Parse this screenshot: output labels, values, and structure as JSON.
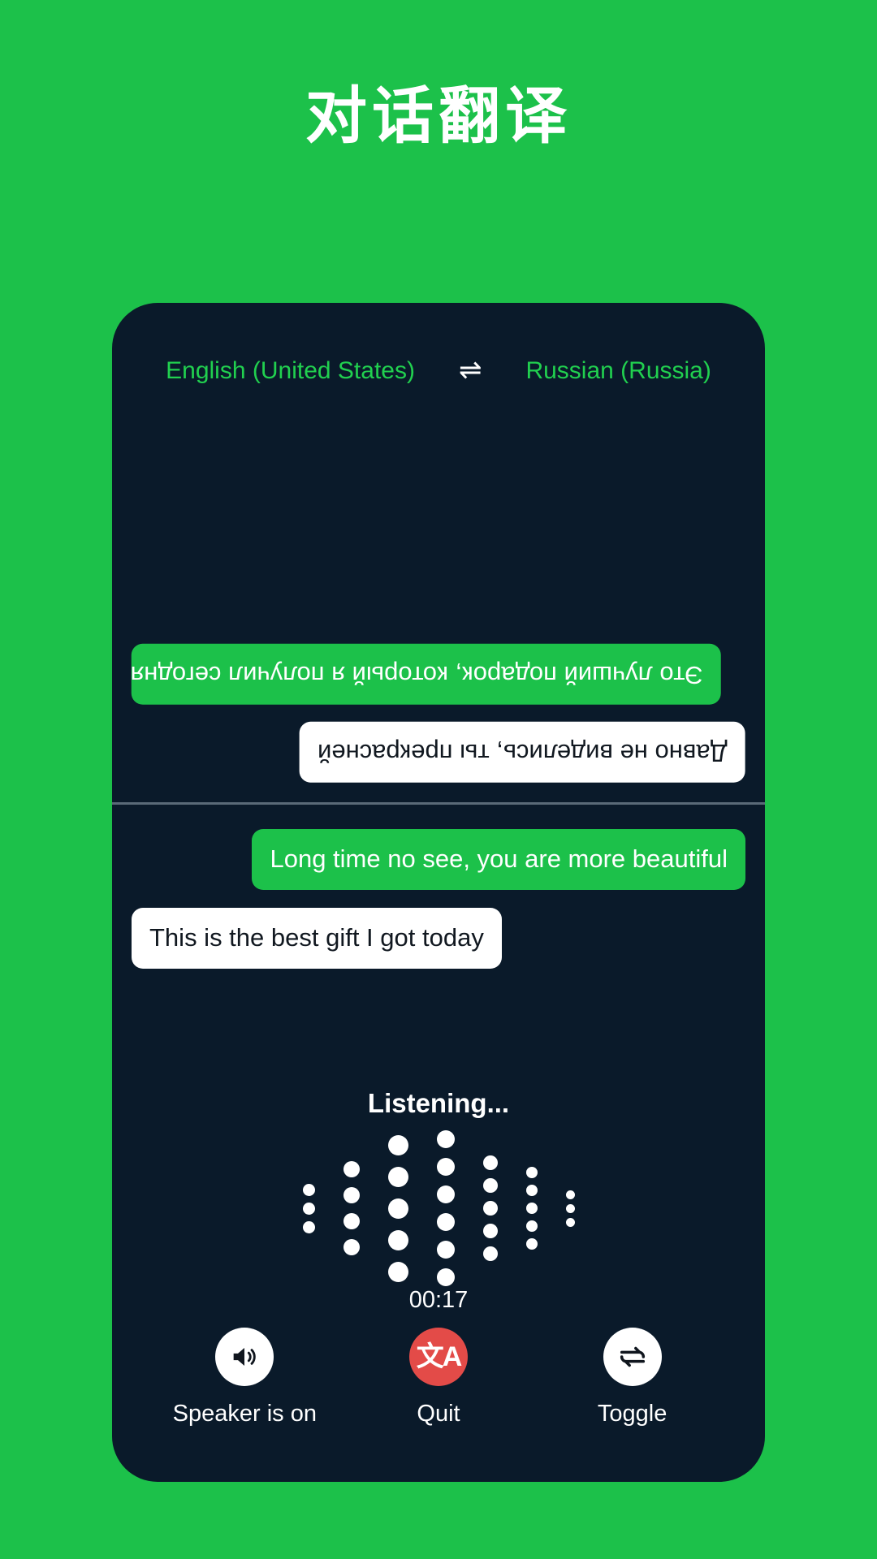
{
  "page": {
    "title": "对话翻译",
    "background_color": "#1CC14A",
    "phone_background_color": "#0A1A2A",
    "accent_green": "#1CC14A",
    "bubble_green": "#1CC14A",
    "quit_red": "#E34B48"
  },
  "language_bar": {
    "source": "English (United States)",
    "swap_icon": "swap-horizontal-icon",
    "swap_glyph": "⇌",
    "target": "Russian (Russia)"
  },
  "conversation": {
    "remote_pane": {
      "messages": [
        {
          "text": "Это лучший подарок, который я получил сегодня",
          "style": "green",
          "align": "left",
          "rotated": true
        },
        {
          "text": "Давно не виделись, ты прекрасней",
          "style": "white",
          "align": "right",
          "rotated": true
        }
      ]
    },
    "local_pane": {
      "messages": [
        {
          "text": "Long time no see, you are more beautiful",
          "style": "green",
          "align": "right",
          "rotated": false
        },
        {
          "text": "This is the best gift I got today",
          "style": "white",
          "align": "left",
          "rotated": false
        }
      ]
    }
  },
  "status": {
    "listening_label": "Listening...",
    "timer": "00:17"
  },
  "waveform": {
    "columns": [
      {
        "count": 3,
        "size": 15
      },
      {
        "count": 4,
        "size": 20
      },
      {
        "count": 5,
        "size": 25
      },
      {
        "count": 6,
        "size": 22
      },
      {
        "count": 5,
        "size": 18
      },
      {
        "count": 5,
        "size": 14
      },
      {
        "count": 3,
        "size": 11
      }
    ]
  },
  "controls": [
    {
      "icon": "speaker-on-icon",
      "label": "Speaker is on",
      "circle_color": "#FFFFFF"
    },
    {
      "icon": "translate-icon",
      "glyph": "文A",
      "label": "Quit",
      "circle_color": "#E34B48"
    },
    {
      "icon": "toggle-swap-icon",
      "label": "Toggle",
      "circle_color": "#FFFFFF"
    }
  ]
}
